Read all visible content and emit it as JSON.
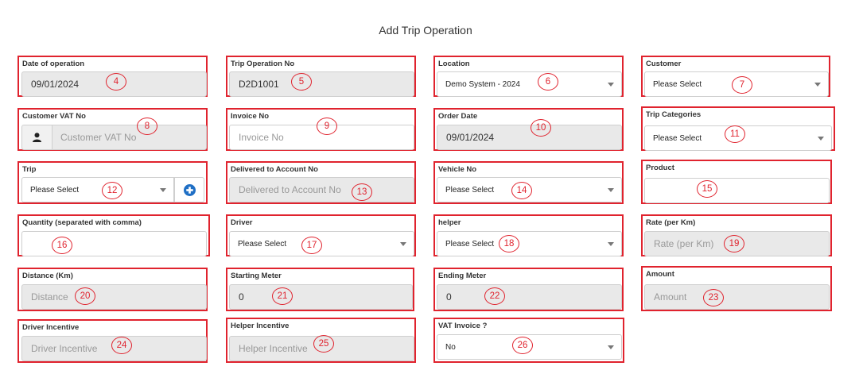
{
  "page": {
    "title": "Add Trip Operation"
  },
  "fields": {
    "date_of_operation": {
      "label": "Date of operation",
      "value": "09/01/2024",
      "marker": "4"
    },
    "trip_operation_no": {
      "label": "Trip Operation No",
      "value": "D2D1001",
      "marker": "5"
    },
    "location": {
      "label": "Location",
      "value": "Demo System - 2024",
      "marker": "6"
    },
    "customer": {
      "label": "Customer",
      "value": "Please Select",
      "marker": "7"
    },
    "customer_vat_no": {
      "label": "Customer VAT No",
      "placeholder": "Customer VAT No",
      "icon": "user-icon",
      "marker": "8"
    },
    "invoice_no": {
      "label": "Invoice No",
      "placeholder": "Invoice No",
      "marker": "9"
    },
    "order_date": {
      "label": "Order Date",
      "value": "09/01/2024",
      "marker": "10"
    },
    "trip_categories": {
      "label": "Trip Categories",
      "value": "Please Select",
      "marker": "11"
    },
    "trip": {
      "label": "Trip",
      "value": "Please Select",
      "add_icon": "plus-circle-icon",
      "marker": "12"
    },
    "delivered_to_account_no": {
      "label": "Delivered to Account No",
      "placeholder": "Delivered to Account No",
      "marker": "13"
    },
    "vehicle_no": {
      "label": "Vehicle No",
      "value": "Please Select",
      "marker": "14"
    },
    "product": {
      "label": "Product",
      "value": "",
      "marker": "15"
    },
    "quantity": {
      "label": "Quantity (separated with comma)",
      "value": "",
      "marker": "16"
    },
    "driver": {
      "label": "Driver",
      "value": "Please Select",
      "marker": "17"
    },
    "helper": {
      "label": "helper",
      "value": "Please Select",
      "marker": "18"
    },
    "rate_per_km": {
      "label": "Rate (per Km)",
      "placeholder": "Rate (per Km)",
      "marker": "19"
    },
    "distance_km": {
      "label": "Distance (Km)",
      "placeholder": "Distance",
      "marker": "20"
    },
    "starting_meter": {
      "label": "Starting Meter",
      "value": "0",
      "marker": "21"
    },
    "ending_meter": {
      "label": "Ending Meter",
      "value": "0",
      "marker": "22"
    },
    "amount": {
      "label": "Amount",
      "placeholder": "Amount",
      "marker": "23"
    },
    "driver_incentive": {
      "label": "Driver Incentive",
      "placeholder": "Driver Incentive",
      "marker": "24"
    },
    "helper_incentive": {
      "label": "Helper Incentive",
      "placeholder": "Helper Incentive",
      "marker": "25"
    },
    "vat_invoice": {
      "label": "VAT Invoice ?",
      "value": "No",
      "marker": "26"
    }
  },
  "colors": {
    "annotation": "#e0232e",
    "readonly_bg": "#e9e9e9",
    "add_button": "#1f6fc5"
  }
}
